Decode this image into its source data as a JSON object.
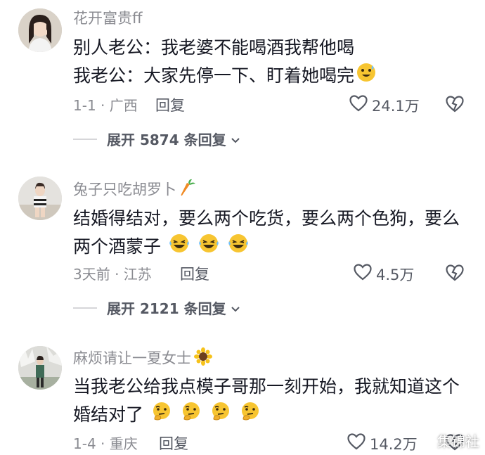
{
  "comments": [
    {
      "username": "花开富贵ff",
      "lines": [
        "别人老公：我老婆不能喝酒我帮他喝",
        "我老公：大家先停一下、盯着她喝完"
      ],
      "emoji": "sweat-grin-emoji",
      "meta": "1-1 · 广西",
      "reply_label": "回复",
      "likes": "24.1万",
      "expand_label": "展开 5874 条回复"
    },
    {
      "username": "兔子只吃胡罗卜",
      "lines": [
        "结婚得结对，要么两个吃货，要么两个色狗，要么",
        "两个酒蒙子"
      ],
      "emoji": "laughing-tears-emoji",
      "meta": "3天前 · 江苏",
      "reply_label": "回复",
      "likes": "4.5万",
      "expand_label": "展开 2121 条回复"
    },
    {
      "username": "麻烦请让一夏女士",
      "lines": [
        "当我老公给我点模子哥那一刻开始，我就知道这个",
        "婚结对了"
      ],
      "emoji": "thinking-face-emoji",
      "meta": "1-4 · 重庆",
      "reply_label": "回复",
      "likes": "14.2万"
    }
  ],
  "watermark": "集锦社",
  "colors": {
    "text_primary": "#161823",
    "text_secondary": "#8a8b91",
    "emoji_yellow": "#f7c531"
  }
}
